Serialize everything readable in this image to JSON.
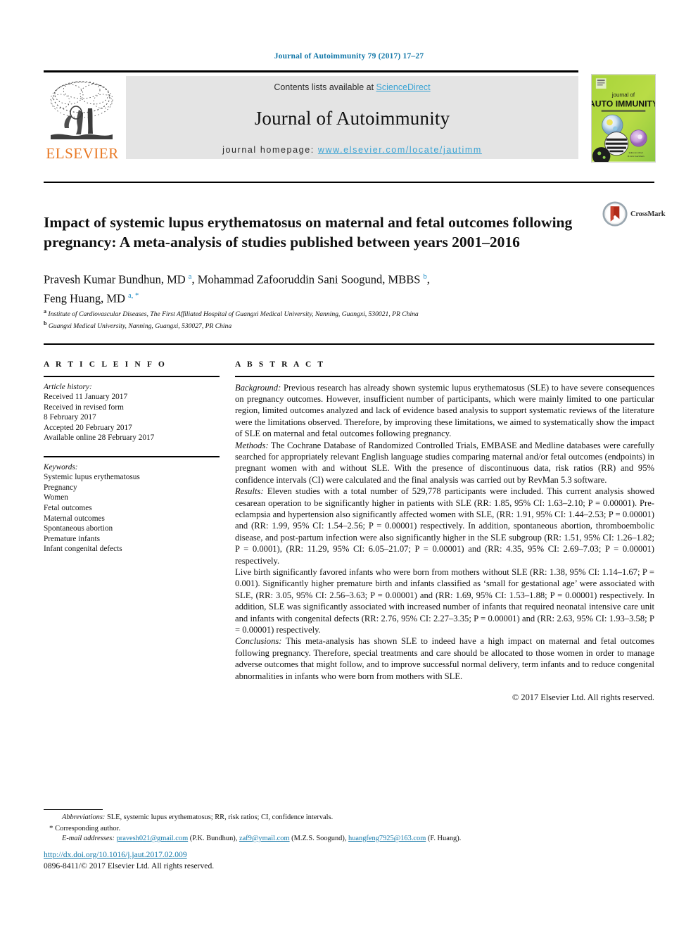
{
  "running_head": "Journal of Autoimmunity 79 (2017) 17–27",
  "masthead": {
    "publisher": "ELSEVIER",
    "contents_prefix": "Contents lists available at ",
    "contents_link": "ScienceDirect",
    "journal_name": "Journal of Autoimmunity",
    "homepage_label": "journal homepage: ",
    "homepage_url": "www.elsevier.com/locate/jautimm",
    "cover_alt": "journal-cover-thumbnail",
    "cover_line1": "journal of",
    "cover_line2": "AUTO IMMUNITY"
  },
  "crossmark": {
    "label": "CrossMark"
  },
  "title": "Impact of systemic lupus erythematosus on maternal and fetal outcomes following pregnancy: A meta-analysis of studies published between years 2001–2016",
  "authors_html": "Pravesh Kumar Bundhun, MD <sup>a</sup>, Mohammad Zafooruddin Sani Soogund, MBBS <sup>b</sup>, <br>Feng Huang, MD <sup>a, *</sup>",
  "affiliations": [
    {
      "marker": "a",
      "text": "Institute of Cardiovascular Diseases, The First Affiliated Hospital of Guangxi Medical University, Nanning, Guangxi, 530021, PR China"
    },
    {
      "marker": "b",
      "text": "Guangxi Medical University, Nanning, Guangxi, 530027, PR China"
    }
  ],
  "article_info": {
    "heading": "A R T I C L E   I N F O",
    "history_label": "Article history:",
    "history": [
      "Received 11 January 2017",
      "Received in revised form",
      "8 February 2017",
      "Accepted 20 February 2017",
      "Available online 28 February 2017"
    ],
    "keywords_label": "Keywords:",
    "keywords": [
      "Systemic lupus erythematosus",
      "Pregnancy",
      "Women",
      "Fetal outcomes",
      "Maternal outcomes",
      "Spontaneous abortion",
      "Premature infants",
      "Infant congenital defects"
    ]
  },
  "abstract": {
    "heading": "A B S T R A C T",
    "sections": [
      {
        "label": "Background:",
        "text": " Previous research has already shown systemic lupus erythematosus (SLE) to have severe consequences on pregnancy outcomes. However, insufficient number of participants, which were mainly limited to one particular region, limited outcomes analyzed and lack of evidence based analysis to support systematic reviews of the literature were the limitations observed. Therefore, by improving these limitations, we aimed to systematically show the impact of SLE on maternal and fetal outcomes following pregnancy."
      },
      {
        "label": "Methods:",
        "text": " The Cochrane Database of Randomized Controlled Trials, EMBASE and Medline databases were carefully searched for appropriately relevant English language studies comparing maternal and/or fetal outcomes (endpoints) in pregnant women with and without SLE. With the presence of discontinuous data, risk ratios (RR) and 95% confidence intervals (CI) were calculated and the final analysis was carried out by RevMan 5.3 software."
      },
      {
        "label": "Results:",
        "text": " Eleven studies with a total number of 529,778 participants were included. This current analysis showed cesarean operation to be significantly higher in patients with SLE (RR: 1.85, 95% CI: 1.63–2.10; P = 0.00001). Pre-eclampsia and hypertension also significantly affected women with SLE, (RR: 1.91, 95% CI: 1.44–2.53; P = 0.00001) and (RR: 1.99, 95% CI: 1.54–2.56; P = 0.00001) respectively. In addition, spontaneous abortion, thromboembolic disease, and post-partum infection were also significantly higher in the SLE subgroup (RR: 1.51, 95% CI: 1.26–1.82; P = 0.0001), (RR: 11.29, 95% CI: 6.05–21.07; P = 0.00001) and (RR: 4.35, 95% CI: 2.69–7.03; P = 0.00001) respectively."
      },
      {
        "label": "",
        "text": "Live birth significantly favored infants who were born from mothers without SLE (RR: 1.38, 95% CI: 1.14–1.67; P = 0.001). Significantly higher premature birth and infants classified as ‘small for gestational age’ were associated with SLE, (RR: 3.05, 95% CI: 2.56–3.63; P = 0.00001) and (RR: 1.69, 95% CI: 1.53–1.88; P = 0.00001) respectively. In addition, SLE was significantly associated with increased number of infants that required neonatal intensive care unit and infants with congenital defects (RR: 2.76, 95% CI: 2.27–3.35; P = 0.00001) and (RR: 2.63, 95% CI: 1.93–3.58; P = 0.00001) respectively."
      },
      {
        "label": "Conclusions:",
        "text": " This meta-analysis has shown SLE to indeed have a high impact on maternal and fetal outcomes following pregnancy. Therefore, special treatments and care should be allocated to those women in order to manage adverse outcomes that might follow, and to improve successful normal delivery, term infants and to reduce congenital abnormalities in infants who were born from mothers with SLE."
      }
    ],
    "copyright": "© 2017 Elsevier Ltd. All rights reserved."
  },
  "footnotes": {
    "abbreviations_label": "Abbreviations:",
    "abbreviations_text": " SLE, systemic lupus erythematosus; RR, risk ratios; CI, confidence intervals.",
    "corresponding": "Corresponding author.",
    "email_label": "E-mail addresses:",
    "emails": [
      {
        "address": "pravesh021@gmail.com",
        "owner": "(P.K. Bundhun)"
      },
      {
        "address": "zaf9@ymail.com",
        "owner": "(M.Z.S. Soogund)"
      },
      {
        "address": "huangfeng7925@163.com",
        "owner": "(F. Huang)"
      }
    ]
  },
  "doi": "http://dx.doi.org/10.1016/j.jaut.2017.02.009",
  "issn_line": "0896-8411/© 2017 Elsevier Ltd. All rights reserved.",
  "colors": {
    "link_blue": "#1277a8",
    "sd_blue": "#3aa3d4",
    "elsevier_orange": "#e87722",
    "band_gray": "#e4e4e4"
  }
}
